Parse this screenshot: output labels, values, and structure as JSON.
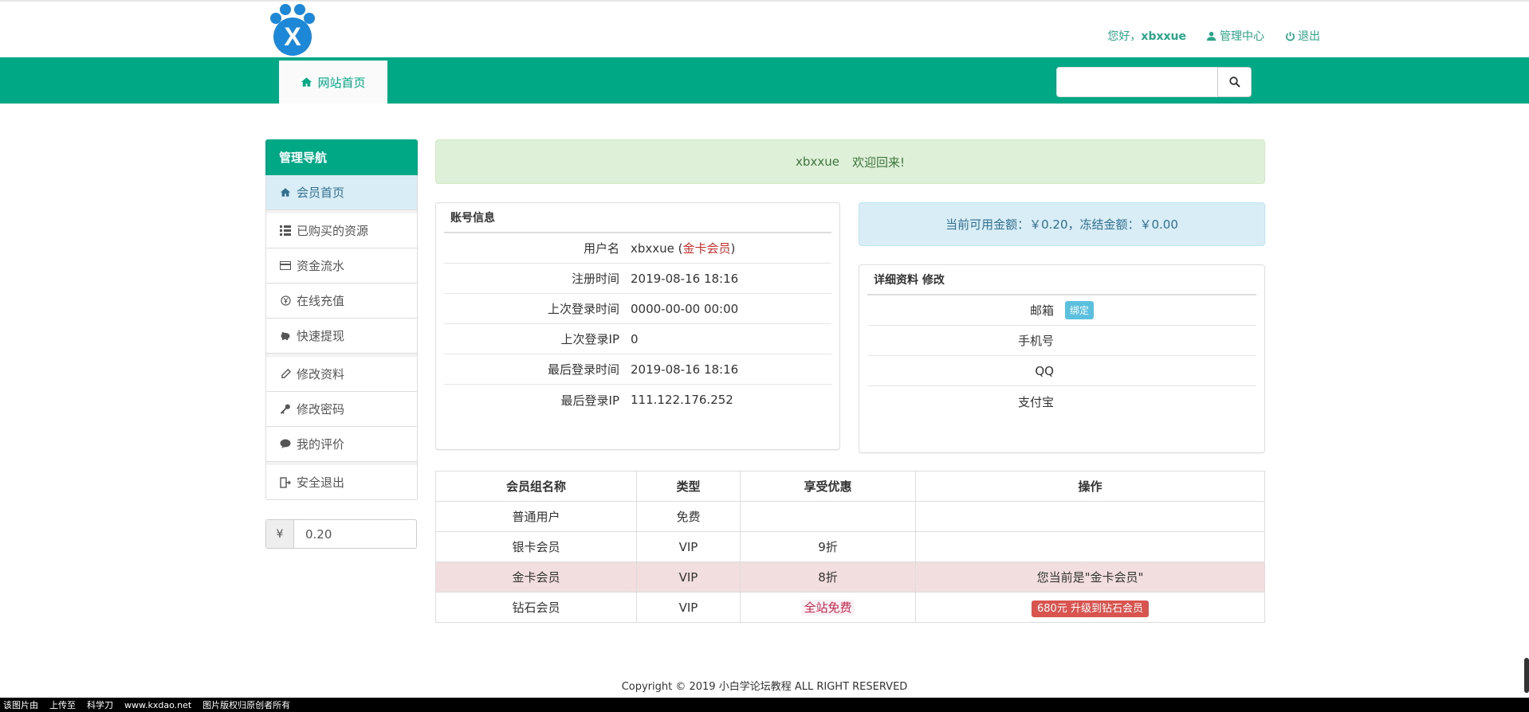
{
  "header": {
    "greeting": "您好，",
    "username": "xbxxue",
    "admin_center": "管理中心",
    "logout": "退出",
    "logo_letter": "X"
  },
  "nav": {
    "home": "网站首页",
    "search_placeholder": ""
  },
  "sidebar": {
    "title": "管理导航",
    "items": [
      {
        "label": "会员首页",
        "icon": "home-icon"
      },
      {
        "label": "已购买的资源",
        "icon": "list-icon"
      },
      {
        "label": "资金流水",
        "icon": "card-icon"
      },
      {
        "label": "在线充值",
        "icon": "yen-circle-icon"
      },
      {
        "label": "快速提现",
        "icon": "piggy-bank-icon"
      },
      {
        "label": "修改资料",
        "icon": "pencil-icon"
      },
      {
        "label": "修改密码",
        "icon": "key-icon"
      },
      {
        "label": "我的评价",
        "icon": "comment-icon"
      },
      {
        "label": "安全退出",
        "icon": "exit-icon"
      }
    ],
    "balance_symbol": "¥",
    "balance_value": "0.20"
  },
  "welcome": {
    "user": "xbxxue",
    "text": "欢迎回来!"
  },
  "account": {
    "title": "账号信息",
    "rows": [
      {
        "k": "用户名",
        "v": "xbxxue",
        "extra_open": " (",
        "extra": "金卡会员",
        "extra_close": ")"
      },
      {
        "k": "注册时间",
        "v": "2019-08-16 18:16"
      },
      {
        "k": "上次登录时间",
        "v": "0000-00-00 00:00"
      },
      {
        "k": "上次登录IP",
        "v": "0"
      },
      {
        "k": "最后登录时间",
        "v": "2019-08-16 18:16"
      },
      {
        "k": "最后登录IP",
        "v": "111.122.176.252"
      }
    ]
  },
  "amount": {
    "text": "当前可用金额：￥0.20，冻结金额：￥0.00"
  },
  "detail": {
    "title": "详细资料 修改",
    "rows": [
      {
        "k": "邮箱",
        "badge": "绑定"
      },
      {
        "k": "手机号"
      },
      {
        "k": "QQ"
      },
      {
        "k": "支付宝"
      }
    ]
  },
  "groups": {
    "headers": [
      "会员组名称",
      "类型",
      "享受优惠",
      "操作"
    ],
    "rows": [
      {
        "name": "普通用户",
        "type": "免费",
        "discount": "",
        "action": ""
      },
      {
        "name": "银卡会员",
        "type": "VIP",
        "discount": "9折",
        "action": ""
      },
      {
        "name": "金卡会员",
        "type": "VIP",
        "discount": "8折",
        "action": "您当前是\"金卡会员\""
      },
      {
        "name": "钻石会员",
        "type": "VIP",
        "discount": "全站免费",
        "action": "680元 升级到钻石会员"
      }
    ]
  },
  "footer": {
    "copyright": "Copyright © 2019 小白学论坛教程 ALL RIGHT RESERVED"
  },
  "watermark": {
    "items": [
      "该图片由",
      "上传至",
      "科学刀",
      "www.kxdao.net",
      "图片版权归原创者所有"
    ]
  },
  "colors": {
    "brand": "#00a886",
    "success_bg": "#dff0d8",
    "info_bg": "#d9edf7",
    "danger_row": "#f2dede"
  }
}
